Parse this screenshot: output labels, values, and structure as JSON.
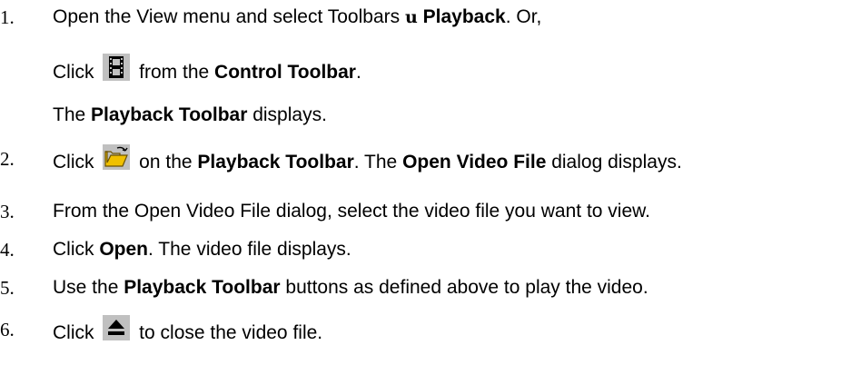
{
  "steps": [
    {
      "num": "1.",
      "parts": {
        "a": "Open the View menu and select Toolbars ",
        "symbol": "u",
        "b": " ",
        "bold1": "Playback",
        "c": ". Or,"
      },
      "sub1": {
        "a": "Click ",
        "icon": "film-icon",
        "b": " from the ",
        "bold1": "Control Toolbar",
        "c": "."
      },
      "sub2": {
        "bold1": "Playback Toolbar",
        "a": " displays.",
        "pre": "The "
      }
    },
    {
      "num": "2.",
      "parts": {
        "a": "Click ",
        "icon": "open-folder-icon",
        "b": " on the ",
        "bold1": "Playback Toolbar",
        "c": ". The ",
        "bold2": "Open Video File",
        "d": " dialog displays."
      }
    },
    {
      "num": "3.",
      "parts": {
        "a": "From the Open Video File dialog, select the video file you want to view."
      }
    },
    {
      "num": "4.",
      "parts": {
        "a": "Click ",
        "bold1": "Open",
        "b": ". The video file displays."
      }
    },
    {
      "num": "5.",
      "parts": {
        "a": "Use the ",
        "bold1": "Playback Toolbar",
        "b": " buttons as defined above to play the video."
      }
    },
    {
      "num": "6.",
      "parts": {
        "a": "Click ",
        "icon": "eject-icon",
        "b": " to close the video file."
      }
    }
  ],
  "colors": {
    "text": "#000000",
    "icon_bg": "#c0c0c0",
    "folder": "#f0c000"
  }
}
